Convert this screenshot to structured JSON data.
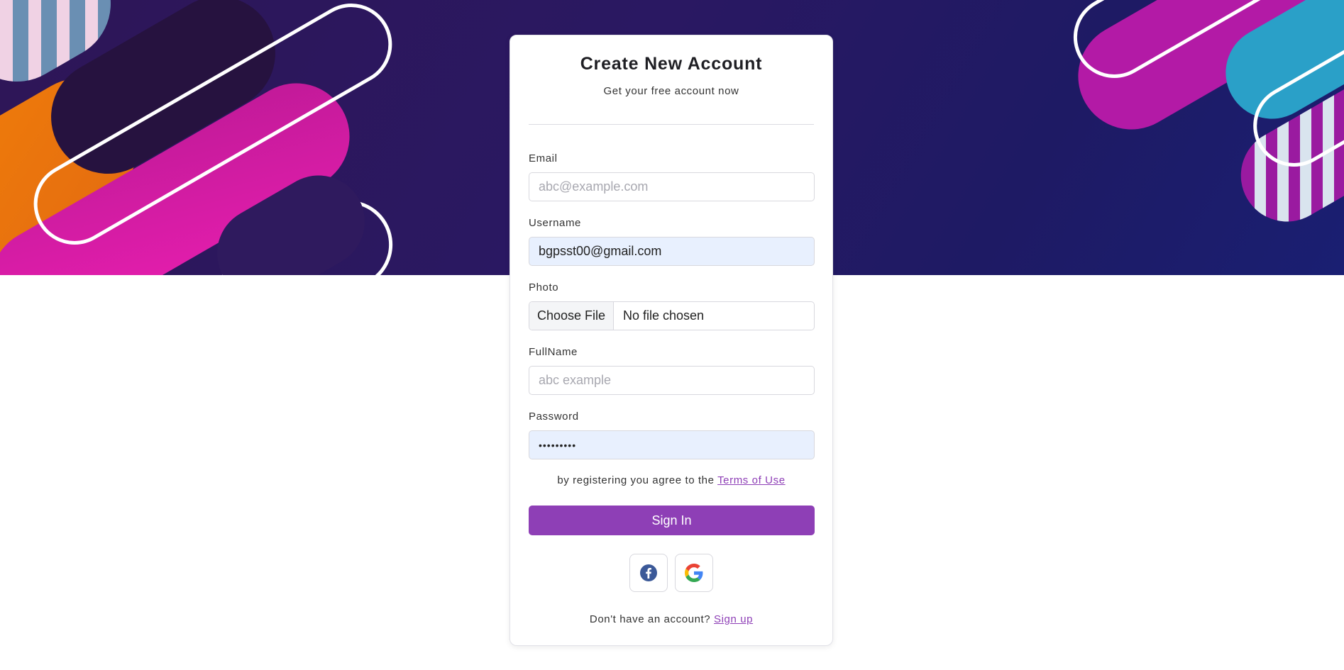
{
  "header": {
    "title": "Create New Account",
    "subtitle": "Get your free account now"
  },
  "form": {
    "email": {
      "label": "Email",
      "placeholder": "abc@example.com",
      "value": ""
    },
    "username": {
      "label": "Username",
      "value": "bgpsst00@gmail.com"
    },
    "photo": {
      "label": "Photo",
      "button_label": "Choose File",
      "status": "No file chosen"
    },
    "fullname": {
      "label": "FullName",
      "placeholder": "abc example",
      "value": ""
    },
    "password": {
      "label": "Password",
      "value": "•••••••••"
    }
  },
  "terms": {
    "prefix": "by registering you agree to the",
    "link": "Terms of Use"
  },
  "submit_label": "Sign In",
  "social": {
    "facebook_icon": "facebook-icon",
    "google_icon": "google-icon"
  },
  "signup": {
    "prefix": "Don't have an account?",
    "link": "Sign up"
  },
  "colors": {
    "accent": "#8e3fb6",
    "hero_bg": "#2a1862",
    "facebook": "#3b5998"
  }
}
